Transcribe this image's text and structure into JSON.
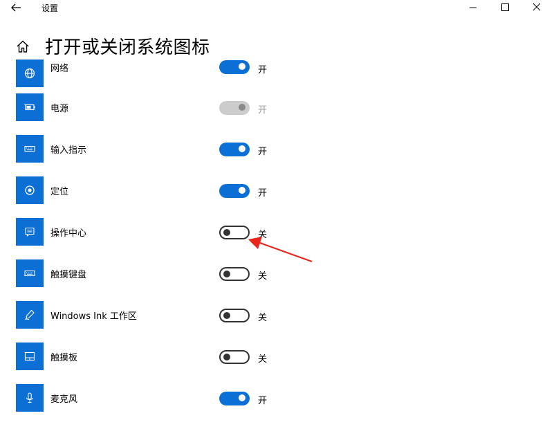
{
  "window": {
    "title": "设置",
    "back_icon": "back-arrow-icon",
    "controls": [
      "minimize-icon",
      "maximize-icon",
      "close-icon"
    ]
  },
  "header": {
    "home_icon": "home-icon",
    "title": "打开或关闭系统图标"
  },
  "items": [
    {
      "label": "网络",
      "icon": "globe-icon",
      "state": "开",
      "on": true,
      "disabled": false
    },
    {
      "label": "电源",
      "icon": "battery-icon",
      "state": "开",
      "on": true,
      "disabled": true
    },
    {
      "label": "输入指示",
      "icon": "keyboard-icon",
      "state": "开",
      "on": true,
      "disabled": false
    },
    {
      "label": "定位",
      "icon": "location-icon",
      "state": "开",
      "on": true,
      "disabled": false
    },
    {
      "label": "操作中心",
      "icon": "action-center-icon",
      "state": "关",
      "on": false,
      "disabled": false
    },
    {
      "label": "触摸键盘",
      "icon": "keyboard-icon",
      "state": "关",
      "on": false,
      "disabled": false
    },
    {
      "label": "Windows Ink 工作区",
      "icon": "pen-icon",
      "state": "关",
      "on": false,
      "disabled": false
    },
    {
      "label": "触摸板",
      "icon": "touchpad-icon",
      "state": "关",
      "on": false,
      "disabled": false
    },
    {
      "label": "麦克风",
      "icon": "microphone-icon",
      "state": "开",
      "on": true,
      "disabled": false
    }
  ],
  "colors": {
    "accent": "#0b6fd6",
    "toggle_off_border": "#333333",
    "toggle_disabled": "#cccccc",
    "annotation_arrow": "#e8261c"
  }
}
